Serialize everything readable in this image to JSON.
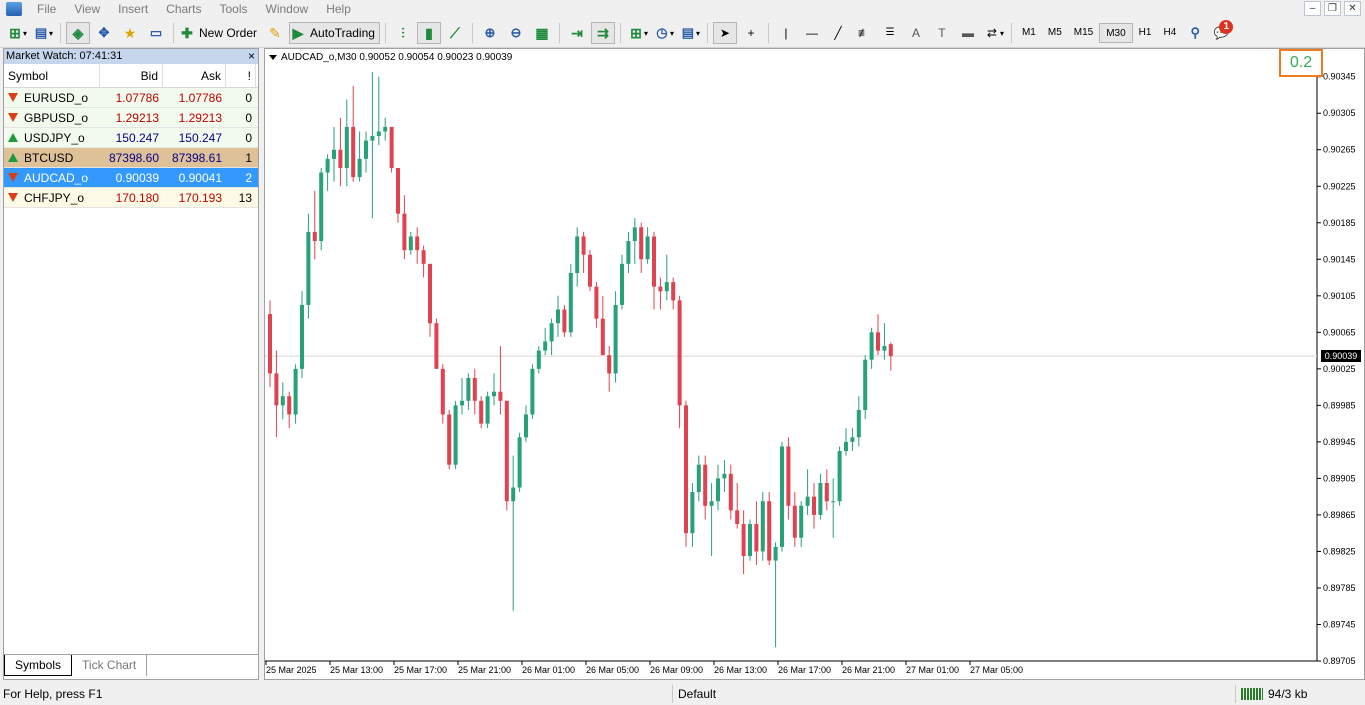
{
  "menu": [
    "File",
    "View",
    "Insert",
    "Charts",
    "Tools",
    "Window",
    "Help"
  ],
  "toolbar": {
    "new_order": "New Order",
    "autotrading": "AutoTrading",
    "timeframes": [
      "M1",
      "M5",
      "M15",
      "M30",
      "H1",
      "H4"
    ],
    "active_timeframe": "M30",
    "notification_count": "1"
  },
  "market_watch": {
    "title": "Market Watch: 07:41:31",
    "close": "×",
    "headers": {
      "symbol": "Symbol",
      "bid": "Bid",
      "ask": "Ask",
      "spread": "!"
    },
    "rows": [
      {
        "symbol": "EURUSD_o",
        "bid": "1.07786",
        "ask": "1.07786",
        "spread": "0",
        "dir": "down",
        "style": "pale-green",
        "color": "red"
      },
      {
        "symbol": "GBPUSD_o",
        "bid": "1.29213",
        "ask": "1.29213",
        "spread": "0",
        "dir": "down",
        "style": "pale-green",
        "color": "red"
      },
      {
        "symbol": "USDJPY_o",
        "bid": "150.247",
        "ask": "150.247",
        "spread": "0",
        "dir": "up",
        "style": "pale-green",
        "color": "blue"
      },
      {
        "symbol": "BTCUSD",
        "bid": "87398.60",
        "ask": "87398.61",
        "spread": "1",
        "dir": "up",
        "style": "btc",
        "color": "blue"
      },
      {
        "symbol": "AUDCAD_o",
        "bid": "0.90039",
        "ask": "0.90041",
        "spread": "2",
        "dir": "down",
        "style": "sel",
        "color": "red"
      },
      {
        "symbol": "CHFJPY_o",
        "bid": "170.180",
        "ask": "170.193",
        "spread": "13",
        "dir": "down",
        "style": "pale-yellow",
        "color": "red"
      }
    ],
    "tabs": [
      "Symbols",
      "Tick Chart"
    ]
  },
  "chart": {
    "title": "AUDCAD_o,M30  0.90052 0.90054 0.90023 0.90039",
    "spread_value": "0.2",
    "current_price": "0.90039",
    "price_axis": [
      "0.90345",
      "0.90305",
      "0.90265",
      "0.90225",
      "0.90185",
      "0.90145",
      "0.90105",
      "0.90065",
      "0.90025",
      "0.89985",
      "0.89945",
      "0.89905",
      "0.89865",
      "0.89825",
      "0.89785",
      "0.89745",
      "0.89705"
    ],
    "time_axis": [
      "25 Mar 2025",
      "25 Mar 13:00",
      "25 Mar 17:00",
      "25 Mar 21:00",
      "26 Mar 01:00",
      "26 Mar 05:00",
      "26 Mar 09:00",
      "26 Mar 13:00",
      "26 Mar 17:00",
      "26 Mar 21:00",
      "27 Mar 01:00",
      "27 Mar 05:00"
    ],
    "colors": {
      "bull": "#26a17a",
      "bear": "#e0424f"
    }
  },
  "chart_data": {
    "type": "candlestick",
    "title": "AUDCAD_o,M30",
    "ylim": [
      0.89705,
      0.9036
    ],
    "candles": [
      [
        0.90085,
        0.901,
        0.90005,
        0.9002
      ],
      [
        0.9002,
        0.90045,
        0.8995,
        0.89985
      ],
      [
        0.89985,
        0.9001,
        0.8997,
        0.89995
      ],
      [
        0.89995,
        0.9,
        0.8996,
        0.89975
      ],
      [
        0.89975,
        0.9003,
        0.89965,
        0.90025
      ],
      [
        0.90025,
        0.9011,
        0.90015,
        0.90095
      ],
      [
        0.90095,
        0.90195,
        0.9008,
        0.90175
      ],
      [
        0.90175,
        0.9022,
        0.90145,
        0.90165
      ],
      [
        0.90165,
        0.90245,
        0.90155,
        0.9024
      ],
      [
        0.9024,
        0.9026,
        0.9022,
        0.90255
      ],
      [
        0.90255,
        0.9029,
        0.9023,
        0.90265
      ],
      [
        0.90265,
        0.903,
        0.90225,
        0.90245
      ],
      [
        0.90245,
        0.9032,
        0.90225,
        0.9029
      ],
      [
        0.9029,
        0.90335,
        0.9023,
        0.90235
      ],
      [
        0.90235,
        0.90285,
        0.9023,
        0.90255
      ],
      [
        0.90255,
        0.90285,
        0.9024,
        0.90275
      ],
      [
        0.90275,
        0.9035,
        0.9019,
        0.9028
      ],
      [
        0.9028,
        0.90345,
        0.9027,
        0.90285
      ],
      [
        0.90285,
        0.903,
        0.90275,
        0.9029
      ],
      [
        0.9029,
        0.9029,
        0.9024,
        0.90245
      ],
      [
        0.90245,
        0.90245,
        0.90185,
        0.90195
      ],
      [
        0.90195,
        0.90215,
        0.90145,
        0.90155
      ],
      [
        0.90155,
        0.90175,
        0.9015,
        0.9017
      ],
      [
        0.9017,
        0.9018,
        0.9014,
        0.90155
      ],
      [
        0.90155,
        0.9016,
        0.90125,
        0.9014
      ],
      [
        0.9014,
        0.9014,
        0.9006,
        0.90075
      ],
      [
        0.90075,
        0.9008,
        0.9004,
        0.90025
      ],
      [
        0.90025,
        0.9003,
        0.89965,
        0.89975
      ],
      [
        0.89975,
        0.8998,
        0.89915,
        0.8992
      ],
      [
        0.8992,
        0.8999,
        0.89915,
        0.89985
      ],
      [
        0.89985,
        0.90015,
        0.89975,
        0.8999
      ],
      [
        0.8999,
        0.9002,
        0.8998,
        0.90015
      ],
      [
        0.90015,
        0.90025,
        0.89975,
        0.8999
      ],
      [
        0.8999,
        0.89995,
        0.8996,
        0.89965
      ],
      [
        0.89965,
        0.9,
        0.8996,
        0.89995
      ],
      [
        0.89995,
        0.9002,
        0.89985,
        0.9
      ],
      [
        0.9,
        0.9005,
        0.89975,
        0.8999
      ],
      [
        0.8999,
        0.8999,
        0.8987,
        0.8988
      ],
      [
        0.8988,
        0.8993,
        0.8976,
        0.89895
      ],
      [
        0.89895,
        0.89955,
        0.8989,
        0.8995
      ],
      [
        0.8995,
        0.89985,
        0.89945,
        0.89975
      ],
      [
        0.89975,
        0.9003,
        0.8997,
        0.90025
      ],
      [
        0.90025,
        0.9005,
        0.9002,
        0.90045
      ],
      [
        0.90045,
        0.9007,
        0.9004,
        0.90055
      ],
      [
        0.90055,
        0.9008,
        0.9004,
        0.90075
      ],
      [
        0.90075,
        0.90105,
        0.9006,
        0.9009
      ],
      [
        0.9009,
        0.90095,
        0.9006,
        0.90065
      ],
      [
        0.90065,
        0.9014,
        0.9006,
        0.9013
      ],
      [
        0.9013,
        0.9018,
        0.90115,
        0.9017
      ],
      [
        0.9017,
        0.90175,
        0.9013,
        0.9015
      ],
      [
        0.9015,
        0.90155,
        0.9011,
        0.90115
      ],
      [
        0.90115,
        0.9012,
        0.9007,
        0.9008
      ],
      [
        0.9008,
        0.90105,
        0.9005,
        0.9004
      ],
      [
        0.9004,
        0.9005,
        0.9,
        0.9002
      ],
      [
        0.9002,
        0.9011,
        0.9001,
        0.90095
      ],
      [
        0.90095,
        0.9015,
        0.9009,
        0.9014
      ],
      [
        0.9014,
        0.90175,
        0.9013,
        0.90165
      ],
      [
        0.90165,
        0.9019,
        0.9014,
        0.9018
      ],
      [
        0.9018,
        0.90185,
        0.9013,
        0.90145
      ],
      [
        0.90145,
        0.9018,
        0.9014,
        0.9017
      ],
      [
        0.9017,
        0.90175,
        0.9009,
        0.90115
      ],
      [
        0.90115,
        0.90125,
        0.9009,
        0.9011
      ],
      [
        0.9011,
        0.9015,
        0.901,
        0.9012
      ],
      [
        0.9012,
        0.90125,
        0.9009,
        0.901
      ],
      [
        0.901,
        0.90105,
        0.8996,
        0.89985
      ],
      [
        0.89985,
        0.8999,
        0.8983,
        0.89845
      ],
      [
        0.89845,
        0.899,
        0.8983,
        0.8989
      ],
      [
        0.8989,
        0.8993,
        0.8988,
        0.8992
      ],
      [
        0.8992,
        0.8993,
        0.8986,
        0.89875
      ],
      [
        0.89875,
        0.899,
        0.8982,
        0.8988
      ],
      [
        0.8988,
        0.8992,
        0.8987,
        0.89905
      ],
      [
        0.89905,
        0.89925,
        0.8989,
        0.8991
      ],
      [
        0.8991,
        0.8992,
        0.8986,
        0.8987
      ],
      [
        0.8987,
        0.899,
        0.8985,
        0.89855
      ],
      [
        0.89855,
        0.8987,
        0.898,
        0.8982
      ],
      [
        0.8982,
        0.8986,
        0.89815,
        0.89855
      ],
      [
        0.89855,
        0.8988,
        0.8981,
        0.89825
      ],
      [
        0.89825,
        0.8989,
        0.89815,
        0.8988
      ],
      [
        0.8988,
        0.8989,
        0.8981,
        0.89815
      ],
      [
        0.89815,
        0.89835,
        0.8972,
        0.8983
      ],
      [
        0.8983,
        0.89945,
        0.89825,
        0.8994
      ],
      [
        0.8994,
        0.8995,
        0.8986,
        0.89875
      ],
      [
        0.89875,
        0.8989,
        0.8983,
        0.8984
      ],
      [
        0.8984,
        0.8988,
        0.8983,
        0.89875
      ],
      [
        0.89875,
        0.89915,
        0.89865,
        0.89885
      ],
      [
        0.89885,
        0.899,
        0.8985,
        0.89865
      ],
      [
        0.89865,
        0.8991,
        0.8986,
        0.899
      ],
      [
        0.899,
        0.89915,
        0.8987,
        0.8988
      ],
      [
        0.8988,
        0.89905,
        0.8984,
        0.8988
      ],
      [
        0.8988,
        0.8994,
        0.89875,
        0.89935
      ],
      [
        0.89935,
        0.8996,
        0.8993,
        0.89945
      ],
      [
        0.89945,
        0.8996,
        0.89935,
        0.8995
      ],
      [
        0.8995,
        0.89995,
        0.8994,
        0.8998
      ],
      [
        0.8998,
        0.9004,
        0.8997,
        0.90035
      ],
      [
        0.90035,
        0.9007,
        0.90025,
        0.90065
      ],
      [
        0.90065,
        0.90085,
        0.9004,
        0.90045
      ],
      [
        0.90045,
        0.90075,
        0.90035,
        0.9005
      ],
      [
        0.90052,
        0.90054,
        0.90023,
        0.90039
      ]
    ]
  },
  "status": {
    "help": "For Help, press F1",
    "profile": "Default",
    "traffic": "94/3 kb"
  }
}
